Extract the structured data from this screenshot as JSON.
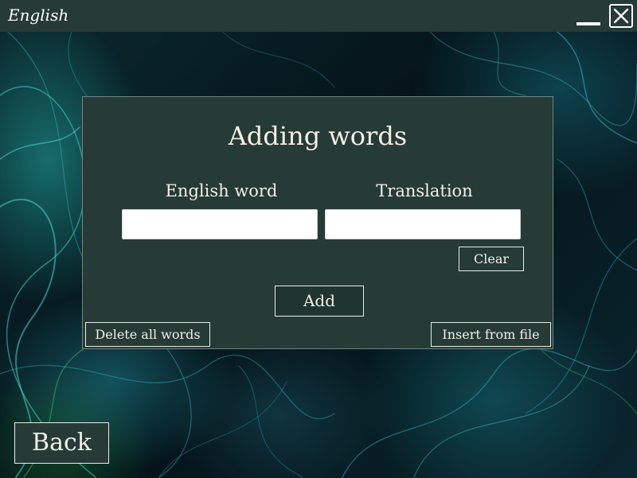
{
  "window": {
    "title": "English",
    "minimize_icon": "minimize-icon",
    "close_icon": "close-icon"
  },
  "dialog": {
    "title": "Adding words",
    "english_label": "English word",
    "translation_label": "Translation",
    "english_value": "",
    "translation_value": "",
    "clear_label": "Clear",
    "add_label": "Add",
    "delete_all_label": "Delete all words",
    "insert_file_label": "Insert from file"
  },
  "nav": {
    "back_label": "Back"
  },
  "colors": {
    "titlebar_bg": "#263a36",
    "panel_bg": "#263a36",
    "text": "#f3f0e8",
    "background_accent": "#2ac8c0"
  }
}
